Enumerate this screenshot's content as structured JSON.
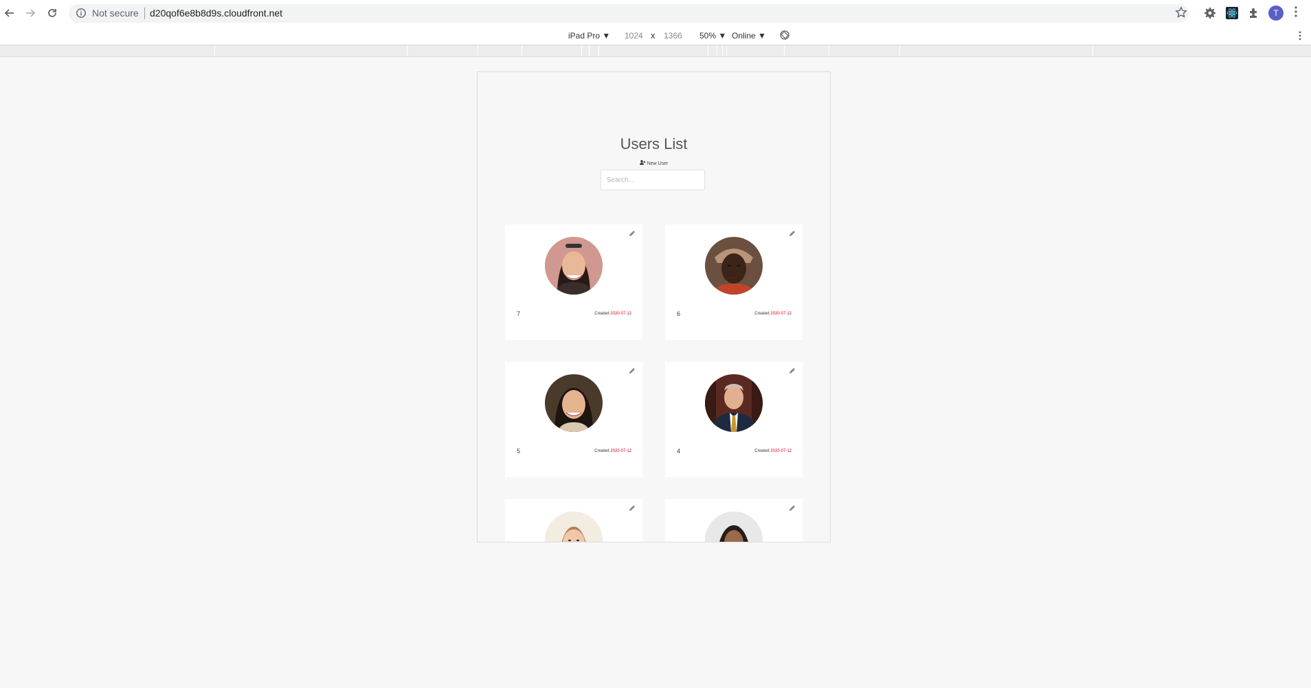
{
  "browser": {
    "security_label": "Not secure",
    "url": "d20qof6e8b8d9s.cloudfront.net",
    "profile_initial": "T"
  },
  "device_toolbar": {
    "device": "iPad Pro",
    "width": "1024",
    "times": "x",
    "height": "1366",
    "zoom": "50%",
    "network": "Online"
  },
  "page": {
    "title": "Users List",
    "new_user_label": "New User",
    "search_placeholder": "Search..."
  },
  "users": [
    {
      "id": "7",
      "created_label": "Created",
      "created_date": "2020-07-12"
    },
    {
      "id": "6",
      "created_label": "Created",
      "created_date": "2020-07-12"
    },
    {
      "id": "5",
      "created_label": "Created",
      "created_date": "2020-07-12"
    },
    {
      "id": "4",
      "created_label": "Created",
      "created_date": "2020-07-12"
    },
    {
      "id": "",
      "created_label": "",
      "created_date": ""
    },
    {
      "id": "",
      "created_label": "",
      "created_date": ""
    }
  ],
  "colors": {
    "accent_date": "#d0021b",
    "profile_avatar": "#5b5fc7"
  }
}
